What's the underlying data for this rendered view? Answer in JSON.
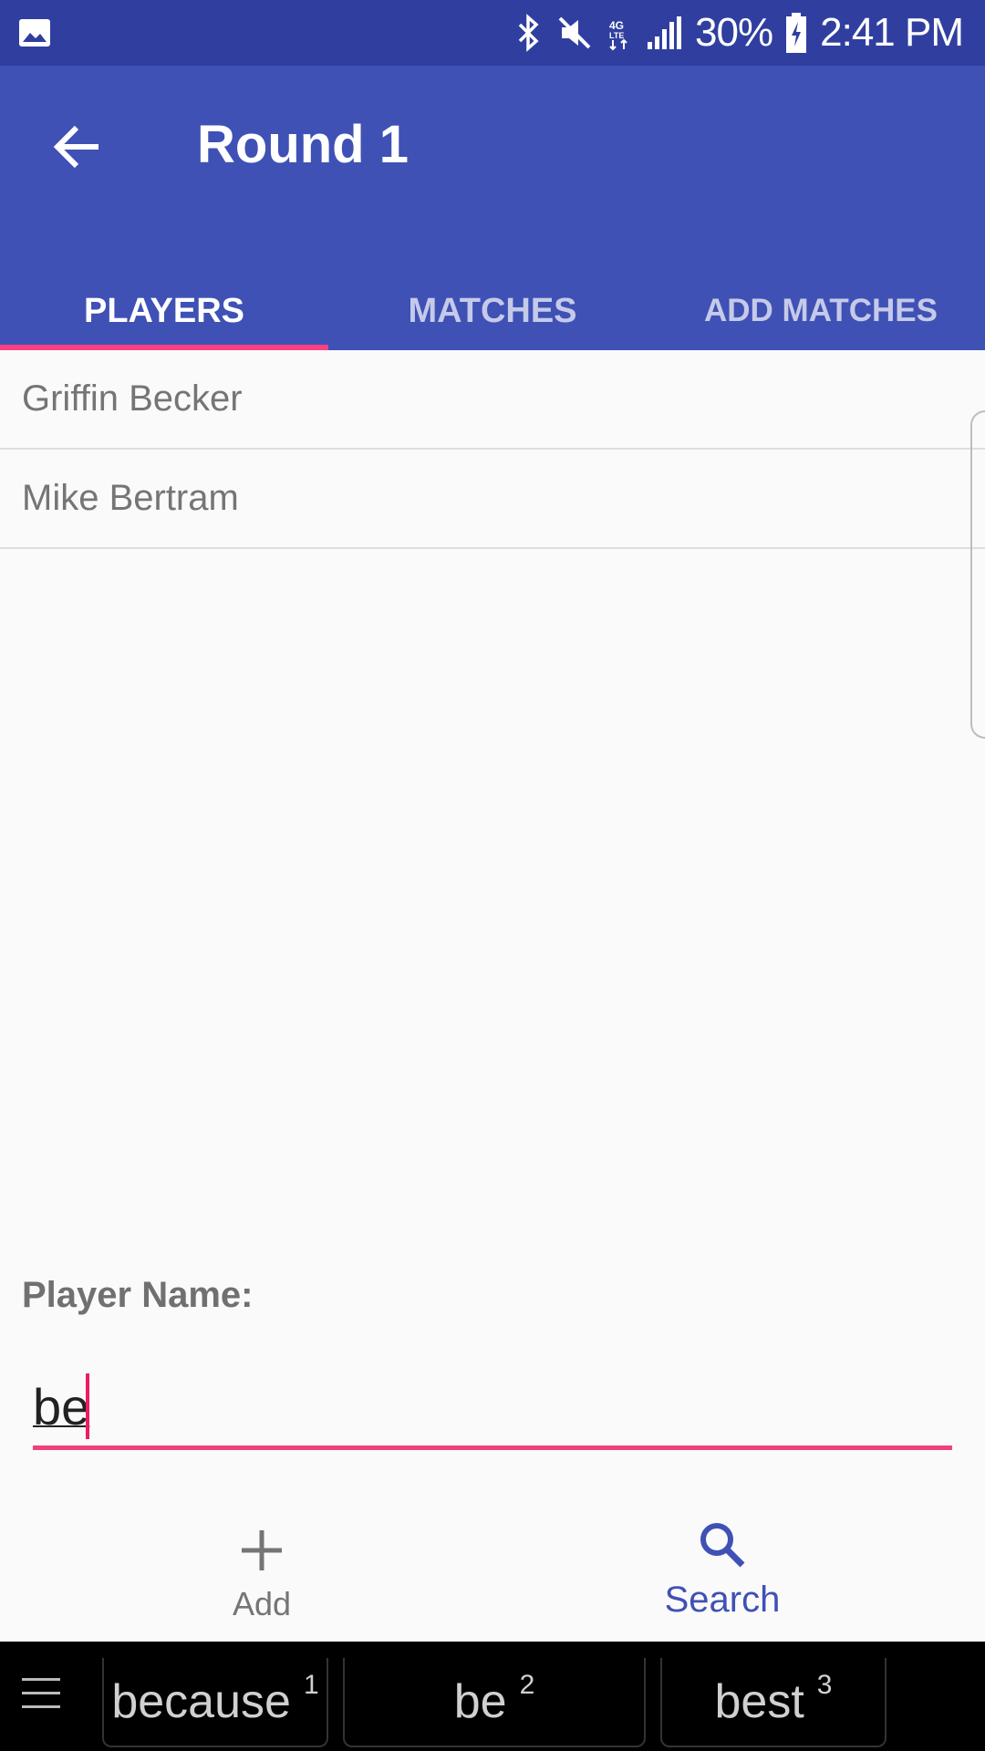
{
  "status_bar": {
    "battery": "30%",
    "time": "2:41 PM",
    "icons": [
      "image-icon",
      "bluetooth-icon",
      "mute-icon",
      "lte-icon",
      "signal-icon",
      "battery-charging-icon"
    ]
  },
  "app_bar": {
    "title": "Round 1",
    "back_icon": "arrow-left-icon",
    "color": "#3f51b5"
  },
  "tabs": [
    {
      "label": "PLAYERS",
      "active": true
    },
    {
      "label": "MATCHES",
      "active": false
    },
    {
      "label": "ADD MATCHES",
      "active": false
    }
  ],
  "players": [
    {
      "name": "Griffin Becker"
    },
    {
      "name": "Mike Bertram"
    }
  ],
  "form": {
    "label": "Player Name:",
    "value": "be"
  },
  "actions": {
    "add_label": "Add",
    "search_label": "Search"
  },
  "keyboard": {
    "suggestions": [
      {
        "word": "because",
        "index": "1"
      },
      {
        "word": "be",
        "index": "2"
      },
      {
        "word": "best",
        "index": "3"
      }
    ]
  },
  "colors": {
    "primary": "#3f51b5",
    "primary_dark": "#303f9f",
    "accent": "#ff4081"
  }
}
